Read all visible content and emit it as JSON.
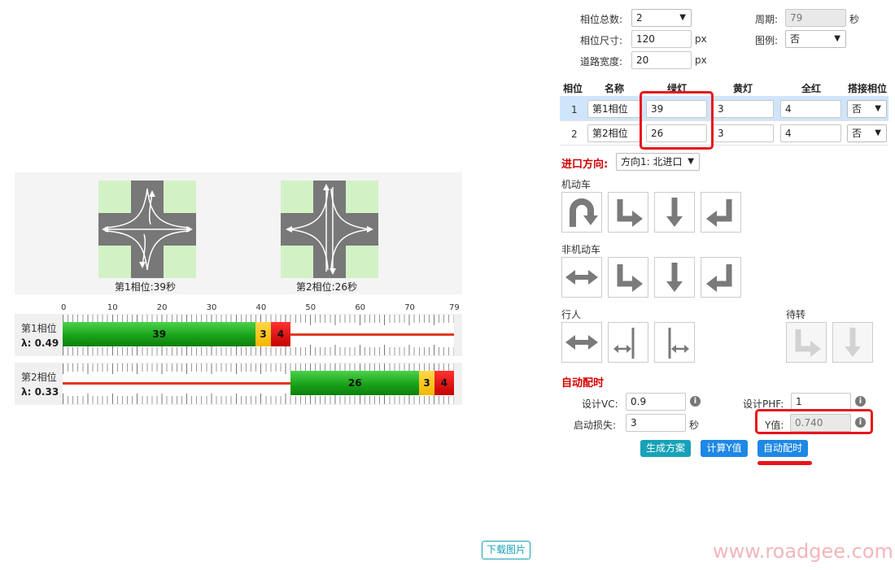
{
  "settings": {
    "phase_count_label": "相位总数:",
    "phase_count_value": "2",
    "cycle_label": "周期:",
    "cycle_value": "79",
    "cycle_unit": "秒",
    "phase_size_label": "相位尺寸:",
    "phase_size_value": "120",
    "phase_size_unit": "px",
    "legend_label": "图例:",
    "legend_value": "否",
    "road_width_label": "道路宽度:",
    "road_width_value": "20",
    "road_width_unit": "px"
  },
  "phase_table": {
    "headers": [
      "相位",
      "名称",
      "绿灯",
      "黄灯",
      "全红",
      "搭接相位"
    ],
    "rows": [
      {
        "num": "1",
        "name": "第1相位",
        "green": "39",
        "yellow": "3",
        "allred": "4",
        "overlap": "否"
      },
      {
        "num": "2",
        "name": "第2相位",
        "green": "26",
        "yellow": "3",
        "allred": "4",
        "overlap": "否"
      }
    ]
  },
  "approach": {
    "label": "进口方向:",
    "value": "方向1: 北进口"
  },
  "movements": {
    "motor_label": "机动车",
    "nonmotor_label": "非机动车",
    "ped_label": "行人",
    "wait_label": "待转"
  },
  "auto": {
    "title": "自动配时",
    "vc_label": "设计VC:",
    "vc_value": "0.9",
    "phf_label": "设计PHF:",
    "phf_value": "1",
    "loss_label": "启动损失:",
    "loss_value": "3",
    "loss_unit": "秒",
    "y_label": "Y值:",
    "y_value": "0.740",
    "btn_generate": "生成方案",
    "btn_calc_y": "计算Y值",
    "btn_auto": "自动配时"
  },
  "diagram": {
    "phase1_caption": "第1相位:39秒",
    "phase2_caption": "第2相位:26秒"
  },
  "timing": {
    "axis_ticks": [
      "0",
      "10",
      "20",
      "30",
      "40",
      "50",
      "60",
      "70",
      "79"
    ],
    "rows": [
      {
        "label": "第1相位",
        "lambda": "λ: 0.49",
        "start": 0,
        "green": 39,
        "yellow": 3,
        "red": 4
      },
      {
        "label": "第2相位",
        "lambda": "λ: 0.33",
        "start": 46,
        "green": 26,
        "yellow": 3,
        "red": 4
      }
    ],
    "cycle": 79
  },
  "download_label": "下载图片",
  "watermark": "www.roadgee.com",
  "colors": {
    "accent_teal": "#17a2b8",
    "accent_blue": "#1e88e5",
    "highlight": "#e8141b"
  }
}
